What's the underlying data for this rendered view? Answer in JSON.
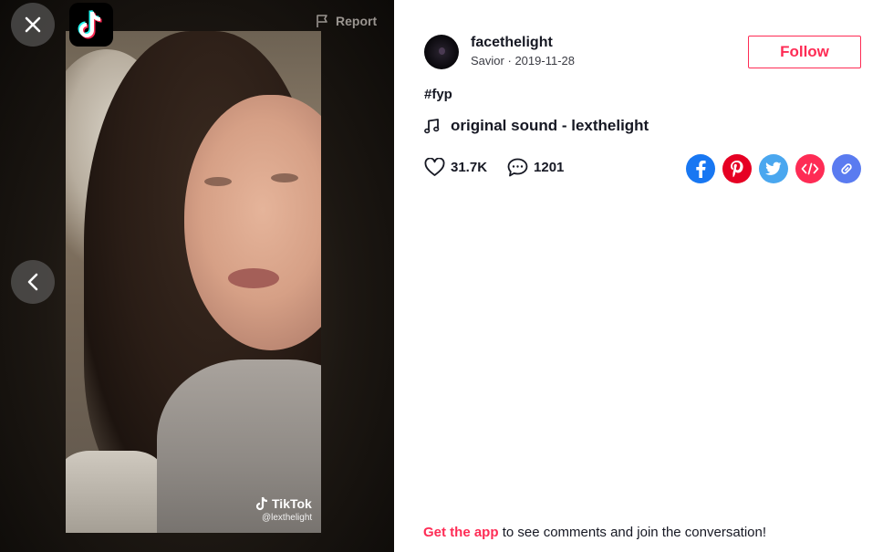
{
  "app": {
    "logo_icon": "tiktok-logo-icon"
  },
  "viewer": {
    "report_label": "Report",
    "watermark_brand": "TikTok",
    "watermark_handle": "@lexthelight"
  },
  "author": {
    "username": "facethelight",
    "nickname": "Savior",
    "separator": "·",
    "date": "2019-11-28"
  },
  "follow_label": "Follow",
  "caption": {
    "hashtag": "#fyp"
  },
  "music": {
    "title": "original sound - lexthelight"
  },
  "stats": {
    "likes": "31.7K",
    "comments": "1201"
  },
  "share": {
    "items": [
      {
        "name": "facebook-share",
        "icon": "facebook-icon",
        "color": "#1877f2"
      },
      {
        "name": "pinterest-share",
        "icon": "pinterest-icon",
        "color": "#e60023"
      },
      {
        "name": "twitter-share",
        "icon": "twitter-icon",
        "color": "#4aa7ef"
      },
      {
        "name": "embed-share",
        "icon": "embed-code-icon",
        "color": "#fe2c55"
      },
      {
        "name": "copy-link-share",
        "icon": "link-icon",
        "color": "#5a7bf0"
      }
    ]
  },
  "cta": {
    "link_text": "Get the app",
    "rest_text": "to see comments and join the conversation!"
  },
  "colors": {
    "brand": "#fe2c55",
    "text": "#161823"
  }
}
